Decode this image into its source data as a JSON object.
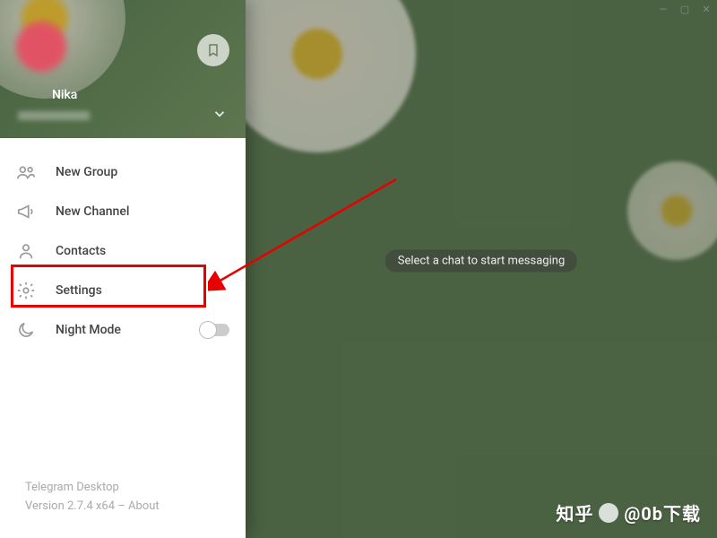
{
  "window": {
    "min": "—",
    "max": "▢",
    "close": "✕"
  },
  "profile": {
    "name": "Nika"
  },
  "menu": {
    "new_group": "New Group",
    "new_channel": "New Channel",
    "contacts": "Contacts",
    "settings": "Settings",
    "night_mode": "Night Mode"
  },
  "footer": {
    "app": "Telegram Desktop",
    "version": "Version 2.7.4 x64 – About"
  },
  "main": {
    "hint": "Select a chat to start messaging"
  },
  "watermark": {
    "text_left": "知乎",
    "text_right": "@0b下载"
  }
}
